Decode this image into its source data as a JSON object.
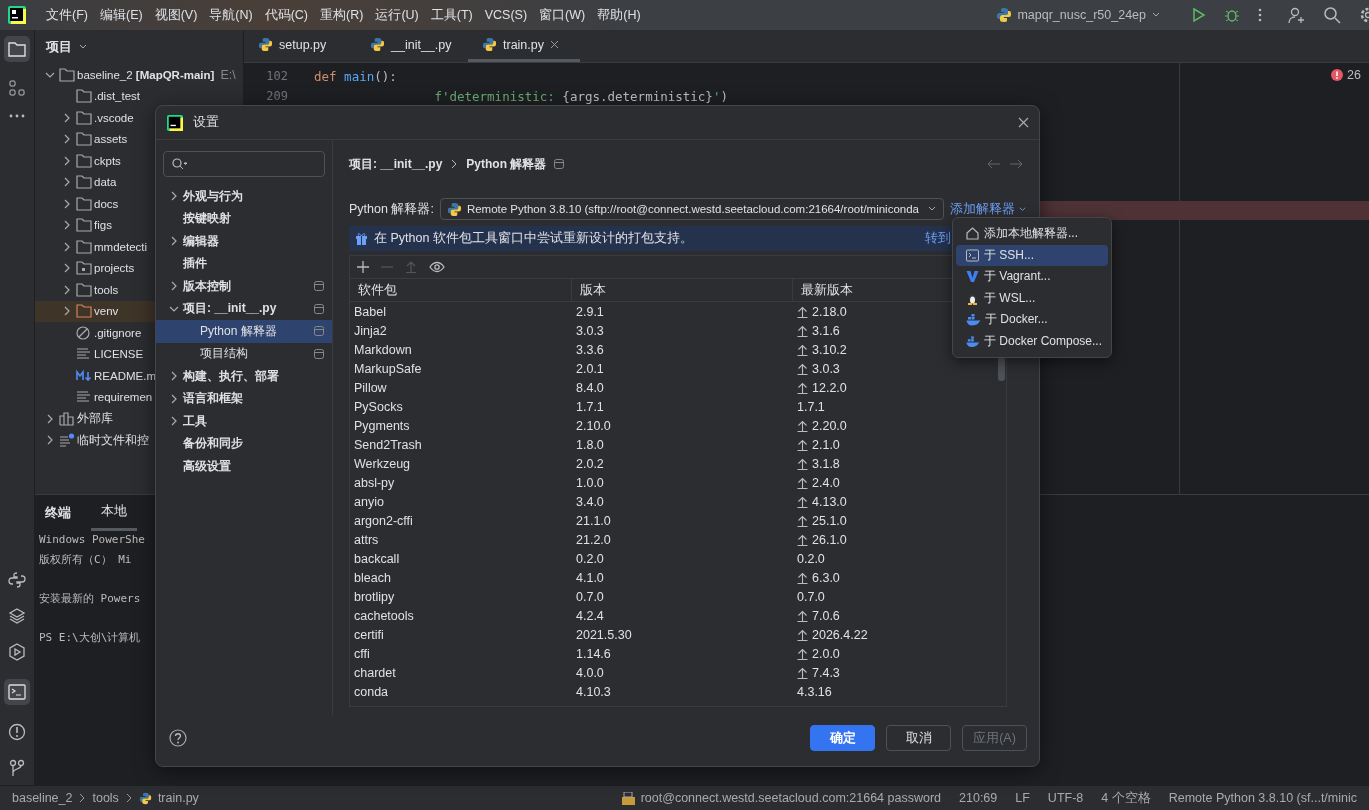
{
  "top_bar": {
    "menus": [
      "文件(F)",
      "编辑(E)",
      "视图(V)",
      "导航(N)",
      "代码(C)",
      "重构(R)",
      "运行(U)",
      "工具(T)",
      "VCS(S)",
      "窗口(W)",
      "帮助(H)"
    ],
    "run_config": "mapqr_nusc_r50_24ep"
  },
  "project_tree": {
    "header": "项目",
    "items": [
      {
        "label": "baseline_2 **[MapQR-main]**",
        "path": "E:\\",
        "kind": "folder",
        "expanded": true,
        "selected": false,
        "children": [
          {
            "label": ".dist_test",
            "kind": "folder",
            "selected": false
          },
          {
            "label": ".vscode",
            "kind": "folder",
            "expanded": false,
            "selected": false
          },
          {
            "label": "assets",
            "kind": "folder",
            "expanded": false,
            "selected": false
          },
          {
            "label": "ckpts",
            "kind": "folder",
            "expanded": false,
            "selected": false
          },
          {
            "label": "data",
            "kind": "folder",
            "expanded": false,
            "selected": false
          },
          {
            "label": "docs",
            "kind": "folder",
            "expanded": false,
            "selected": false
          },
          {
            "label": "figs",
            "kind": "folder",
            "expanded": false,
            "selected": false
          },
          {
            "label": "mmdetecti",
            "kind": "folder",
            "expanded": false,
            "selected": false
          },
          {
            "label": "projects",
            "kind": "module-folder",
            "expanded": false,
            "selected": false
          },
          {
            "label": "tools",
            "kind": "folder",
            "expanded": false,
            "selected": false
          },
          {
            "label": "venv",
            "kind": "excluded-folder",
            "expanded": false,
            "selected": true
          },
          {
            "label": ".gitignore",
            "kind": "ignore-file",
            "selected": false
          },
          {
            "label": "LICENSE",
            "kind": "text-file",
            "selected": false
          },
          {
            "label": "README.m",
            "kind": "markdown-file",
            "selected": false
          },
          {
            "label": "requiremen",
            "kind": "text-file",
            "selected": false
          }
        ]
      },
      {
        "label": "外部库",
        "kind": "library",
        "expanded": false,
        "selected": false
      },
      {
        "label": "临时文件和控",
        "kind": "scratch",
        "expanded": false,
        "selected": false
      }
    ]
  },
  "editor": {
    "tabs": [
      {
        "label": "setup.py",
        "selected": false
      },
      {
        "label": "__init__.py",
        "selected": false
      },
      {
        "label": "train.py",
        "selected": true
      }
    ],
    "error_count": "26",
    "lines": [
      {
        "number": "102",
        "tokens": [
          {
            "text": "def ",
            "kind": "keyword"
          },
          {
            "text": "main",
            "kind": "function"
          },
          {
            "text": "():",
            "kind": "plain"
          }
        ]
      },
      {
        "number": "209",
        "tokens": [
          {
            "text": "                f'deterministic: ",
            "kind": "string"
          },
          {
            "text": "{args.deterministic}",
            "kind": "plain"
          },
          {
            "text": "'",
            "kind": "string"
          },
          {
            "text": ")",
            "kind": "plain"
          }
        ]
      }
    ]
  },
  "terminal": {
    "title": "终端",
    "tabs": [
      {
        "label": "本地",
        "selected": true
      }
    ],
    "blocks": [
      [
        "Windows PowerShe",
        "版权所有（C） Mi"
      ],
      [
        "安装最新的 Powers"
      ],
      [
        "PS E:\\大创\\计算机"
      ]
    ]
  },
  "settings_dialog": {
    "title": "设置",
    "nav": [
      {
        "label": "外观与行为",
        "expanded": false,
        "selected": false,
        "project_level": false
      },
      {
        "label": "按键映射",
        "selected": false,
        "project_level": false
      },
      {
        "label": "编辑器",
        "expanded": false,
        "selected": false,
        "project_level": false
      },
      {
        "label": "插件",
        "selected": false,
        "project_level": false
      },
      {
        "label": "版本控制",
        "expanded": false,
        "selected": false,
        "project_level": true
      },
      {
        "label": "项目: __init__.py",
        "expanded": true,
        "selected": false,
        "project_level": true,
        "children": [
          {
            "label": "Python 解释器",
            "selected": true,
            "project_level": true
          },
          {
            "label": "项目结构",
            "selected": false,
            "project_level": true
          }
        ]
      },
      {
        "label": "构建、执行、部署",
        "expanded": false,
        "selected": false,
        "project_level": false
      },
      {
        "label": "语言和框架",
        "expanded": false,
        "selected": false,
        "project_level": false
      },
      {
        "label": "工具",
        "expanded": false,
        "selected": false,
        "project_level": false
      },
      {
        "label": "备份和同步",
        "selected": false,
        "project_level": false
      },
      {
        "label": "高级设置",
        "selected": false,
        "project_level": false
      }
    ],
    "breadcrumb": [
      "项目: __init__.py",
      "Python 解释器"
    ],
    "interpreter_label": "Python 解释器:",
    "interpreter": "Remote Python 3.8.10 (sftp://root@connect.westd.seetacloud.com:21664/root/miniconda",
    "add_interpreter": "添加解释器",
    "banner": "在 Python 软件包工具窗口中尝试重新设计的打包支持。",
    "banner_link": "转到",
    "toolbar": [
      {
        "kind": "add",
        "disabled": false
      },
      {
        "kind": "remove",
        "disabled": true
      },
      {
        "kind": "upgrade",
        "disabled": true
      },
      {
        "kind": "show",
        "disabled": false
      }
    ],
    "columns": [
      "软件包",
      "版本",
      "最新版本"
    ],
    "packages": [
      {
        "name": "Babel",
        "version": "2.9.1",
        "latest": "2.18.0",
        "upgradable": true
      },
      {
        "name": "Jinja2",
        "version": "3.0.3",
        "latest": "3.1.6",
        "upgradable": true
      },
      {
        "name": "Markdown",
        "version": "3.3.6",
        "latest": "3.10.2",
        "upgradable": true
      },
      {
        "name": "MarkupSafe",
        "version": "2.0.1",
        "latest": "3.0.3",
        "upgradable": true
      },
      {
        "name": "Pillow",
        "version": "8.4.0",
        "latest": "12.2.0",
        "upgradable": true
      },
      {
        "name": "PySocks",
        "version": "1.7.1",
        "latest": "1.7.1",
        "upgradable": false
      },
      {
        "name": "Pygments",
        "version": "2.10.0",
        "latest": "2.20.0",
        "upgradable": true
      },
      {
        "name": "Send2Trash",
        "version": "1.8.0",
        "latest": "2.1.0",
        "upgradable": true
      },
      {
        "name": "Werkzeug",
        "version": "2.0.2",
        "latest": "3.1.8",
        "upgradable": true
      },
      {
        "name": "absl-py",
        "version": "1.0.0",
        "latest": "2.4.0",
        "upgradable": true
      },
      {
        "name": "anyio",
        "version": "3.4.0",
        "latest": "4.13.0",
        "upgradable": true
      },
      {
        "name": "argon2-cffi",
        "version": "21.1.0",
        "latest": "25.1.0",
        "upgradable": true
      },
      {
        "name": "attrs",
        "version": "21.2.0",
        "latest": "26.1.0",
        "upgradable": true
      },
      {
        "name": "backcall",
        "version": "0.2.0",
        "latest": "0.2.0",
        "upgradable": false
      },
      {
        "name": "bleach",
        "version": "4.1.0",
        "latest": "6.3.0",
        "upgradable": true
      },
      {
        "name": "brotlipy",
        "version": "0.7.0",
        "latest": "0.7.0",
        "upgradable": false
      },
      {
        "name": "cachetools",
        "version": "4.2.4",
        "latest": "7.0.6",
        "upgradable": true
      },
      {
        "name": "certifi",
        "version": "2021.5.30",
        "latest": "2026.4.22",
        "upgradable": true
      },
      {
        "name": "cffi",
        "version": "1.14.6",
        "latest": "2.0.0",
        "upgradable": true
      },
      {
        "name": "chardet",
        "version": "4.0.0",
        "latest": "7.4.3",
        "upgradable": true
      },
      {
        "name": "conda",
        "version": "4.10.3",
        "latest": "4.3.16",
        "upgradable": false
      }
    ],
    "buttons": [
      {
        "label": "确定",
        "kind": "primary",
        "disabled": false
      },
      {
        "label": "取消",
        "kind": "normal",
        "disabled": false
      },
      {
        "label": "应用(A)",
        "kind": "normal",
        "disabled": true
      }
    ]
  },
  "add_interpreter_menu": [
    {
      "label": "添加本地解释器...",
      "kind": "local",
      "selected": false
    },
    {
      "label": "于 SSH...",
      "kind": "ssh",
      "selected": true
    },
    {
      "label": "于 Vagrant...",
      "kind": "vagrant",
      "selected": false
    },
    {
      "label": "于 WSL...",
      "kind": "wsl",
      "selected": false
    },
    {
      "label": "于 Docker...",
      "kind": "docker",
      "selected": false
    },
    {
      "label": "于 Docker Compose...",
      "kind": "docker",
      "selected": false
    }
  ],
  "status_bar": {
    "breadcrumb": [
      "baseline_2",
      "tools",
      "train.py"
    ],
    "items": [
      "root@connect.westd.seetacloud.com:21664 password",
      "210:69",
      "LF",
      "UTF-8",
      "4 个空格",
      "Remote Python 3.8.10 (sf...t/minic"
    ]
  }
}
